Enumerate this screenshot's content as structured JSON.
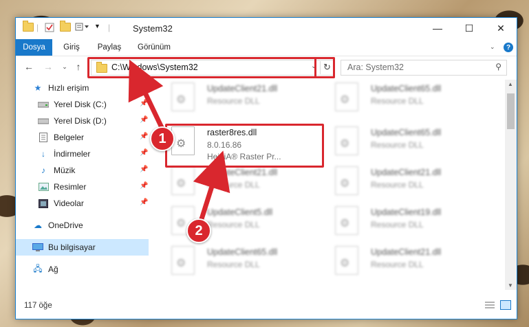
{
  "window": {
    "title": "System32",
    "controls": {
      "minimize": "—",
      "maximize": "☐",
      "close": "✕"
    }
  },
  "ribbon": {
    "tabs": [
      "Dosya",
      "Giriş",
      "Paylaş",
      "Görünüm"
    ],
    "active_tab": "Dosya",
    "help": "?"
  },
  "navigation": {
    "address": "C:\\Windows\\System32",
    "search_placeholder": "Ara: System32"
  },
  "sidebar": {
    "items": [
      {
        "label": "Hızlı erişim",
        "icon": "star-icon"
      },
      {
        "label": "Yerel Disk (C:)",
        "icon": "drive-icon",
        "pinned": true
      },
      {
        "label": "Yerel Disk (D:)",
        "icon": "drive-icon",
        "pinned": true
      },
      {
        "label": "Belgeler",
        "icon": "documents-icon",
        "pinned": true
      },
      {
        "label": "İndirmeler",
        "icon": "download-icon",
        "pinned": true
      },
      {
        "label": "Müzik",
        "icon": "music-icon",
        "pinned": true
      },
      {
        "label": "Resimler",
        "icon": "pictures-icon",
        "pinned": true
      },
      {
        "label": "Videolar",
        "icon": "video-icon",
        "pinned": true
      },
      {
        "label": "OneDrive",
        "icon": "cloud-icon"
      },
      {
        "label": "Bu bilgisayar",
        "icon": "computer-icon",
        "selected": true
      },
      {
        "label": "Ağ",
        "icon": "network-icon"
      }
    ]
  },
  "files": [
    {
      "name": "UpdateClient21.dll",
      "type": "Resource DLL",
      "blurred": true
    },
    {
      "name": "UpdateClient65.dll",
      "type": "Resource DLL",
      "blurred": true
    },
    {
      "name": "raster8res.dll",
      "version": "8.0.16.86",
      "type": "HeidiA® Raster Pr...",
      "blurred": false,
      "highlighted": true
    },
    {
      "name": "UpdateClient65.dll",
      "type": "Resource DLL",
      "blurred": true
    },
    {
      "name": "UpdateClient21.dll",
      "type": "Resource DLL",
      "blurred": true
    },
    {
      "name": "UpdateClient21.dll",
      "type": "Resource DLL",
      "blurred": true
    },
    {
      "name": "UpdateClient5.dll",
      "type": "Resource DLL",
      "blurred": true
    },
    {
      "name": "UpdateClient19.dll",
      "type": "Resource DLL",
      "blurred": true
    },
    {
      "name": "UpdateClient65.dll",
      "type": "Resource DLL",
      "blurred": true
    },
    {
      "name": "UpdateClient21.dll",
      "type": "Resource DLL",
      "blurred": true
    }
  ],
  "status": {
    "count": "117 öğe"
  },
  "annotations": {
    "step1": "1",
    "step2": "2",
    "color": "#d9272e"
  }
}
